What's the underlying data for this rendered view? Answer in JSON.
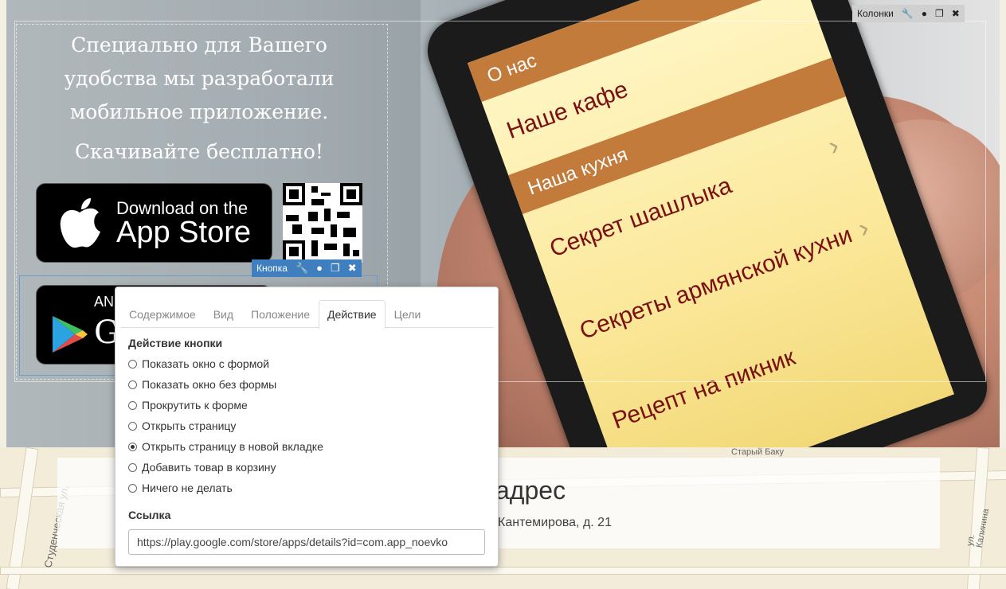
{
  "hero": {
    "promo_lines": [
      "Специально для Вашего",
      "удобства мы разработали",
      "мобильное приложение."
    ],
    "promo_download": "Скачивайте бесплатно!",
    "appstore_small": "Download on the",
    "appstore_big": "App Store",
    "googleplay_small": "AN",
    "googleplay_big": "G"
  },
  "phone_menu": {
    "bars": [
      "О нас",
      "Наша кухня"
    ],
    "items": [
      "Наше кафе",
      "Секрет шашлыка",
      "Секреты армянской кухни",
      "Рецепт на пикник"
    ]
  },
  "editor": {
    "columns_tag": "Колонки",
    "button_tag": "Кнопка"
  },
  "panel": {
    "tabs": [
      "Содержимое",
      "Вид",
      "Положение",
      "Действие",
      "Цели"
    ],
    "active_tab": "Действие",
    "action_label": "Действие кнопки",
    "options": [
      {
        "label": "Показать окно с формой",
        "selected": false
      },
      {
        "label": "Показать окно без формы",
        "selected": false
      },
      {
        "label": "Прокрутить к форме",
        "selected": false
      },
      {
        "label": "Открыть страницу",
        "selected": false
      },
      {
        "label": "Открыть страницу в новой вкладке",
        "selected": true
      },
      {
        "label": "Добавить товар в корзину",
        "selected": false
      },
      {
        "label": "Ничего не делать",
        "selected": false
      }
    ],
    "link_label": "Ссылка",
    "link_value": "https://play.google.com/store/apps/details?id=com.app_noevko"
  },
  "map": {
    "title": "адрес",
    "address": "Кантемирова, д. 21",
    "streets": [
      "Студенческая ул.",
      "Старый Баку",
      "ул. Калинина"
    ]
  }
}
